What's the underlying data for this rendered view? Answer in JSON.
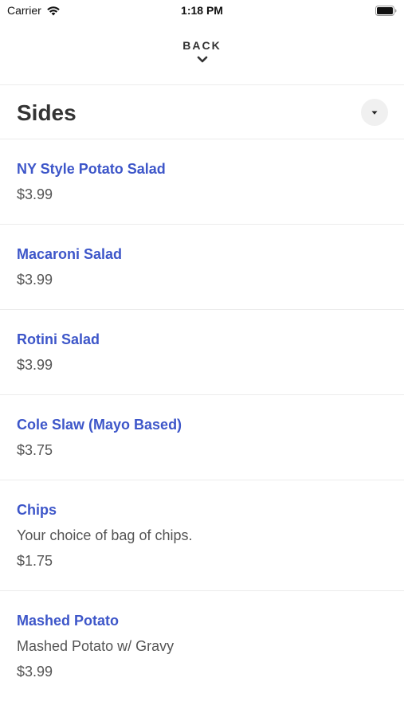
{
  "status_bar": {
    "carrier": "Carrier",
    "time": "1:18 PM",
    "icons": [
      "wifi-icon",
      "battery-icon"
    ]
  },
  "nav": {
    "back_label": "BACK",
    "back_icon": "chevron-down-icon"
  },
  "section": {
    "title": "Sides",
    "toggle_icon": "caret-down-icon"
  },
  "items": [
    {
      "name": "NY Style Potato Salad",
      "description": "",
      "price": "$3.99"
    },
    {
      "name": "Macaroni Salad",
      "description": "",
      "price": "$3.99"
    },
    {
      "name": "Rotini Salad",
      "description": "",
      "price": "$3.99"
    },
    {
      "name": "Cole Slaw (Mayo Based)",
      "description": "",
      "price": "$3.75"
    },
    {
      "name": "Chips",
      "description": "Your choice of bag of chips.",
      "price": "$1.75"
    },
    {
      "name": "Mashed Potato",
      "description": "Mashed Potato w/ Gravy",
      "price": "$3.99"
    }
  ],
  "colors": {
    "item_name": "#3d56c9",
    "text": "#333333",
    "muted": "#555555",
    "divider": "#ececec",
    "toggle_bg": "#f0f0f0"
  }
}
